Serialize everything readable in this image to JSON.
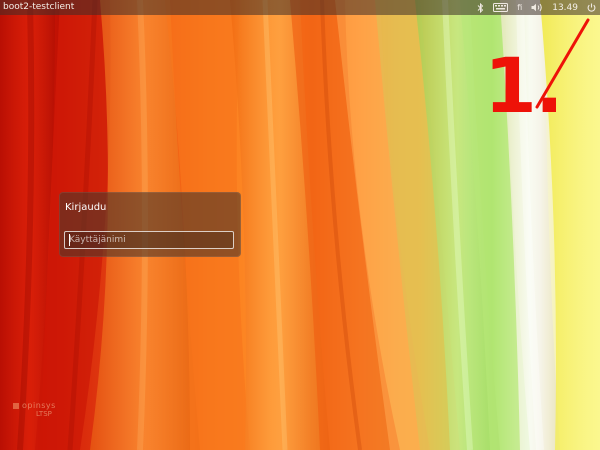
{
  "top_panel": {
    "host_name": "boot2-testclient",
    "clock": "13.49",
    "indicators": [
      {
        "icon": "bluetooth-icon"
      },
      {
        "icon": "keyboard-icon"
      },
      {
        "icon": "keyboard-layout",
        "label": "fi"
      },
      {
        "icon": "volume-icon"
      },
      {
        "icon": "power-icon"
      }
    ]
  },
  "login": {
    "title": "Kirjaudu",
    "username_placeholder": "Käyttäjänimi",
    "username_value": ""
  },
  "annotation": {
    "number": "1.",
    "color": "#ee1208"
  },
  "brand": {
    "name": "opinsys",
    "sub": "LTSP"
  }
}
